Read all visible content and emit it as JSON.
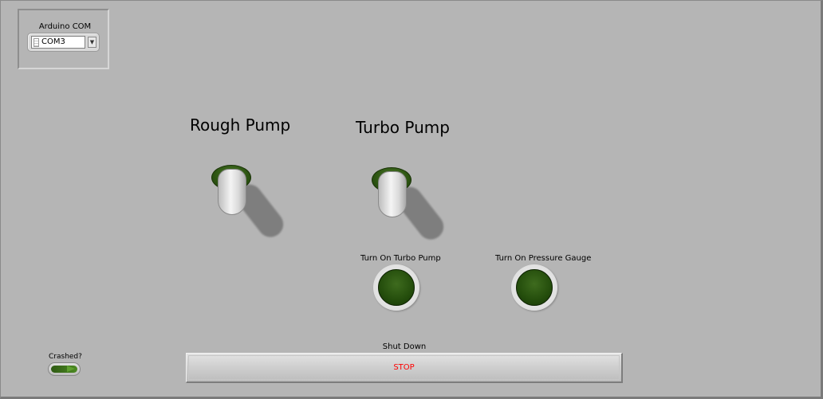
{
  "com": {
    "label": "Arduino COM",
    "value": "COM3"
  },
  "rough_pump": {
    "title": "Rough Pump",
    "state": "off"
  },
  "turbo_pump": {
    "title": "Turbo Pump",
    "state": "off"
  },
  "indicators": {
    "turbo_label": "Turn On Turbo Pump",
    "gauge_label": "Turn On Pressure Gauge",
    "crashed_label": "Crashed?"
  },
  "stop": {
    "group_label": "Shut Down",
    "button_label": "STOP"
  },
  "colors": {
    "background": "#b5b5b5",
    "led_green": "#244d0c",
    "stop_text": "#ff0000"
  },
  "icons": [
    "io-resource-icon",
    "dropdown-arrow-icon"
  ]
}
